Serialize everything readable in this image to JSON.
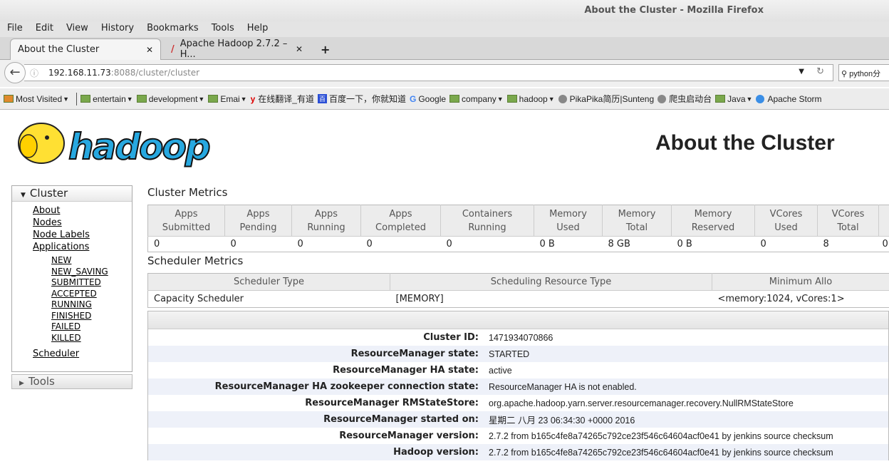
{
  "window": {
    "title": "About the Cluster - Mozilla Firefox"
  },
  "menu": [
    "File",
    "Edit",
    "View",
    "History",
    "Bookmarks",
    "Tools",
    "Help"
  ],
  "tabs": [
    {
      "label": "About the Cluster"
    },
    {
      "label": "Apache Hadoop 2.7.2 – H..."
    }
  ],
  "url": {
    "host": "192.168.11.73",
    "path": ":8088/cluster/cluster"
  },
  "search": {
    "value": "python分"
  },
  "bookmarks": [
    "Most Visited",
    "entertain",
    "development",
    "Emai",
    "在线翻译_有道",
    "百度一下，你就知道",
    "Google",
    "company",
    "hadoop",
    "PikaPika简历|Sunteng",
    "爬虫启动台",
    "Java",
    "Apache Storm"
  ],
  "logo": {
    "text": "hadoop"
  },
  "page": {
    "title": "About the Cluster"
  },
  "sidebar": {
    "cluster": "Cluster",
    "links": [
      "About",
      "Nodes",
      "Node Labels",
      "Applications"
    ],
    "app_states": [
      "NEW",
      "NEW_SAVING",
      "SUBMITTED",
      "ACCEPTED",
      "RUNNING",
      "FINISHED",
      "FAILED",
      "KILLED"
    ],
    "scheduler": "Scheduler",
    "tools": "Tools"
  },
  "cluster_metrics": {
    "title": "Cluster Metrics",
    "headers": [
      [
        "Apps",
        "Submitted"
      ],
      [
        "Apps",
        "Pending"
      ],
      [
        "Apps",
        "Running"
      ],
      [
        "Apps",
        "Completed"
      ],
      [
        "Containers",
        "Running"
      ],
      [
        "Memory",
        "Used"
      ],
      [
        "Memory",
        "Total"
      ],
      [
        "Memory",
        "Reserved"
      ],
      [
        "VCores",
        "Used"
      ],
      [
        "VCores",
        "Total"
      ],
      [
        "",
        ""
      ]
    ],
    "values": [
      "0",
      "0",
      "0",
      "0",
      "0",
      "0 B",
      "8 GB",
      "0 B",
      "0",
      "8",
      "0"
    ]
  },
  "scheduler_metrics": {
    "title": "Scheduler Metrics",
    "headers": [
      "Scheduler Type",
      "Scheduling Resource Type",
      "Minimum Allo"
    ],
    "values": [
      "Capacity Scheduler",
      "[MEMORY]",
      "<memory:1024, vCores:1>"
    ]
  },
  "info": [
    {
      "k": "Cluster ID:",
      "v": "1471934070866"
    },
    {
      "k": "ResourceManager state:",
      "v": "STARTED"
    },
    {
      "k": "ResourceManager HA state:",
      "v": "active"
    },
    {
      "k": "ResourceManager HA zookeeper connection state:",
      "v": "ResourceManager HA is not enabled."
    },
    {
      "k": "ResourceManager RMStateStore:",
      "v": "org.apache.hadoop.yarn.server.resourcemanager.recovery.NullRMStateStore"
    },
    {
      "k": "ResourceManager started on:",
      "v": "星期二 八月 23 06:34:30 +0000 2016"
    },
    {
      "k": "ResourceManager version:",
      "v": "2.7.2 from b165c4fe8a74265c792ce23f546c64604acf0e41 by jenkins source checksum"
    },
    {
      "k": "Hadoop version:",
      "v": "2.7.2 from b165c4fe8a74265c792ce23f546c64604acf0e41 by jenkins source checksum"
    }
  ]
}
